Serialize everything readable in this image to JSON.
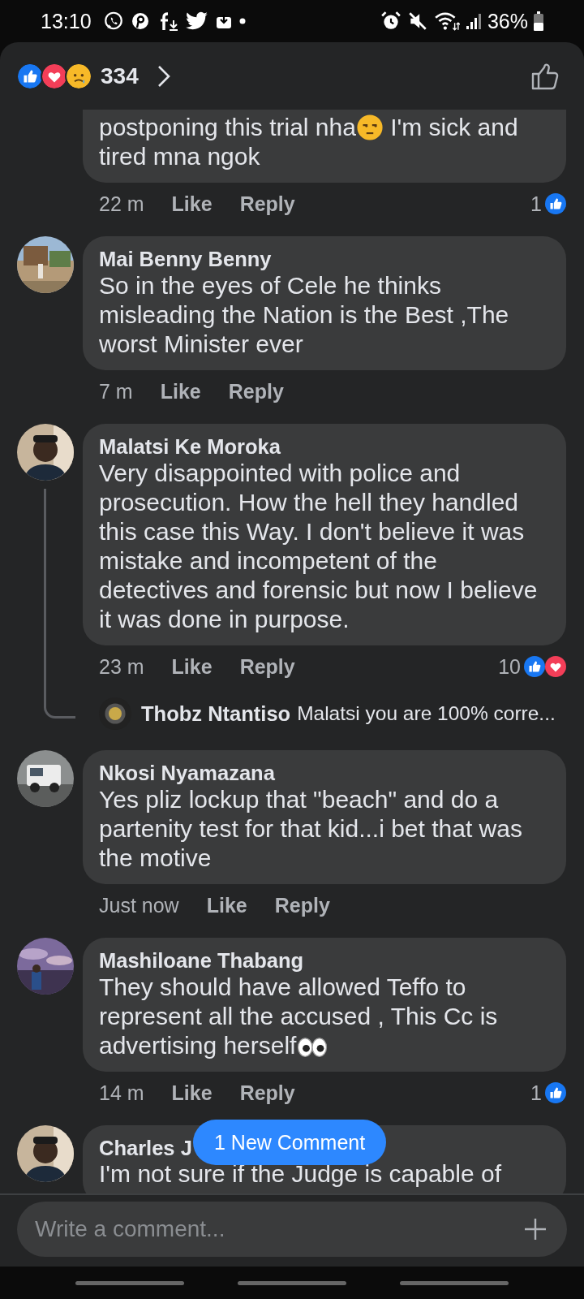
{
  "status_bar": {
    "time": "13:10",
    "battery": "36%"
  },
  "header": {
    "reaction_count": "334"
  },
  "comments": [
    {
      "kind": "partial",
      "text": [
        {
          "kind": "text",
          "value": "postponing this trial nha"
        },
        {
          "kind": "unamused"
        },
        {
          "kind": "text",
          "value": " I'm sick and tired mna ngok"
        }
      ],
      "time": "22 m",
      "like": "Like",
      "reply": "Reply",
      "reaction_count": "1",
      "reactions": [
        {
          "kind": "like"
        }
      ]
    },
    {
      "kind": "full",
      "author": "Mai Benny Benny",
      "text": [
        {
          "kind": "text",
          "value": "So in the eyes of Cele he thinks misleading  the Nation is the Best  ,The worst Minister ever"
        }
      ],
      "time": "7 m",
      "like": "Like",
      "reply": "Reply"
    },
    {
      "kind": "full",
      "author": "Malatsi Ke Moroka",
      "text": [
        {
          "kind": "text",
          "value": "Very disappointed with police and prosecution. How the hell they handled this case this Way. I don't believe it was mistake and incompetent of the detectives and forensic but now I believe it was done in purpose."
        }
      ],
      "time": "23 m",
      "like": "Like",
      "reply": "Reply",
      "reaction_count": "10",
      "reactions": [
        {
          "kind": "like"
        },
        {
          "kind": "love"
        }
      ],
      "reply_preview": {
        "author": "Thobz Ntantiso",
        "text": "Malatsi you are 100% corre..."
      }
    },
    {
      "kind": "full",
      "author": "Nkosi Nyamazana",
      "text": [
        {
          "kind": "text",
          "value": "Yes pliz lockup that \"beach\" and do a partenity test for that kid...i bet that was the motive"
        }
      ],
      "time": "Just now",
      "like": "Like",
      "reply": "Reply"
    },
    {
      "kind": "full",
      "author": "Mashiloane Thabang",
      "text": [
        {
          "kind": "text",
          "value": "They should have allowed Teffo to represent all the accused , This Cc is advertising herself"
        },
        {
          "kind": "eyes"
        }
      ],
      "time": "14 m",
      "like": "Like",
      "reply": "Reply",
      "reaction_count": "1",
      "reactions": [
        {
          "kind": "like"
        }
      ]
    },
    {
      "kind": "cut",
      "author": "Charles J",
      "text": [
        {
          "kind": "text",
          "value": "I'm not sure if the Judge is capable of"
        }
      ]
    }
  ],
  "new_comment_pill": "1 New Comment",
  "composer": {
    "placeholder": "Write a comment..."
  }
}
